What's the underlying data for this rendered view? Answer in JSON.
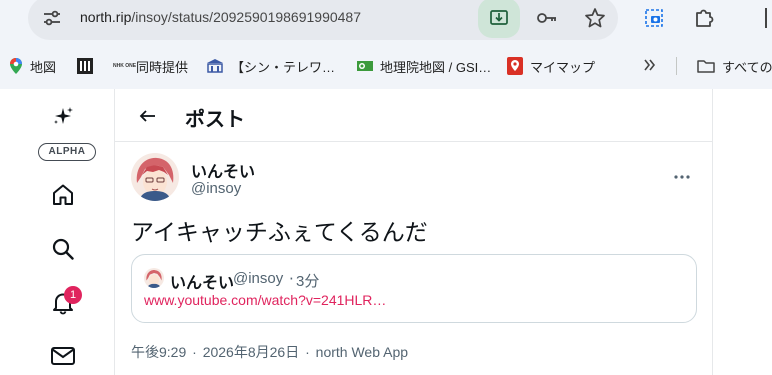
{
  "browser": {
    "url_host": "north.rip",
    "url_path": "/insoy/status/2092590198691990487",
    "bookmarks": [
      {
        "label": "地図",
        "icon": "maps-pin-icon"
      },
      {
        "label": "",
        "icon": "book-icon"
      },
      {
        "label": "同時提供",
        "icon": "nhk-one-icon"
      },
      {
        "label": "【シン・テレワ…",
        "icon": "school-icon"
      },
      {
        "label": "地理院地図 / GSI…",
        "icon": "gsi-map-icon"
      },
      {
        "label": "マイマップ",
        "icon": "mymaps-icon"
      }
    ],
    "all_bookmarks_label": "すべての",
    "nhk_badge_text": "NHK ONE"
  },
  "nav": {
    "alpha_label": "ALPHA",
    "notification_count": "1"
  },
  "header": {
    "title": "ポスト"
  },
  "post": {
    "display_name": "いんそい",
    "handle": "@insoy",
    "text": "アイキャッチふぇてくるんだ",
    "quote": {
      "display_name": "いんそい",
      "handle": "@insoy",
      "separator": "·",
      "time": "3分",
      "link": "www.youtube.com/watch?v=241HLR…"
    },
    "timestamp": "午後9:29",
    "date": "2026年8月26日",
    "client": "north Web App",
    "meta_separator": "·"
  },
  "colors": {
    "accent": "#e0245e",
    "text_primary": "#0f1419",
    "text_secondary": "#536471",
    "border": "#cfd9de"
  }
}
